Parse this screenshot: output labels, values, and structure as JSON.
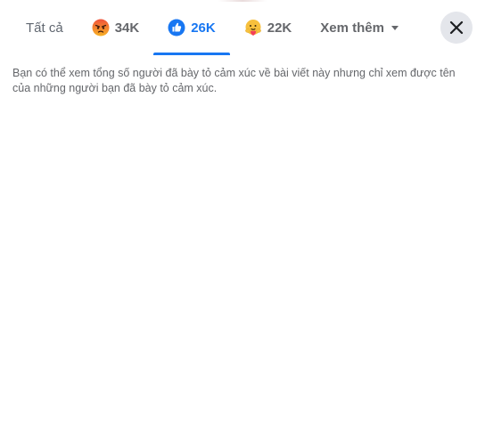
{
  "tabs": [
    {
      "label": "Tất cả",
      "icon": "all"
    },
    {
      "label": "34K",
      "icon": "angry-icon"
    },
    {
      "label": "26K",
      "icon": "like-icon"
    },
    {
      "label": "22K",
      "icon": "care-icon"
    },
    {
      "label": "Xem thêm",
      "icon": "caret-down-icon"
    }
  ],
  "active_tab_index": 2,
  "info_text": "Bạn có thể xem tổng số người đã bày tỏ cảm xúc về bài viết này nhưng chỉ xem được tên của những người bạn đã bày tỏ cảm xúc.",
  "colors": {
    "accent": "#1877f2",
    "text_secondary": "#65676b",
    "close_bg": "#e4e6eb"
  }
}
